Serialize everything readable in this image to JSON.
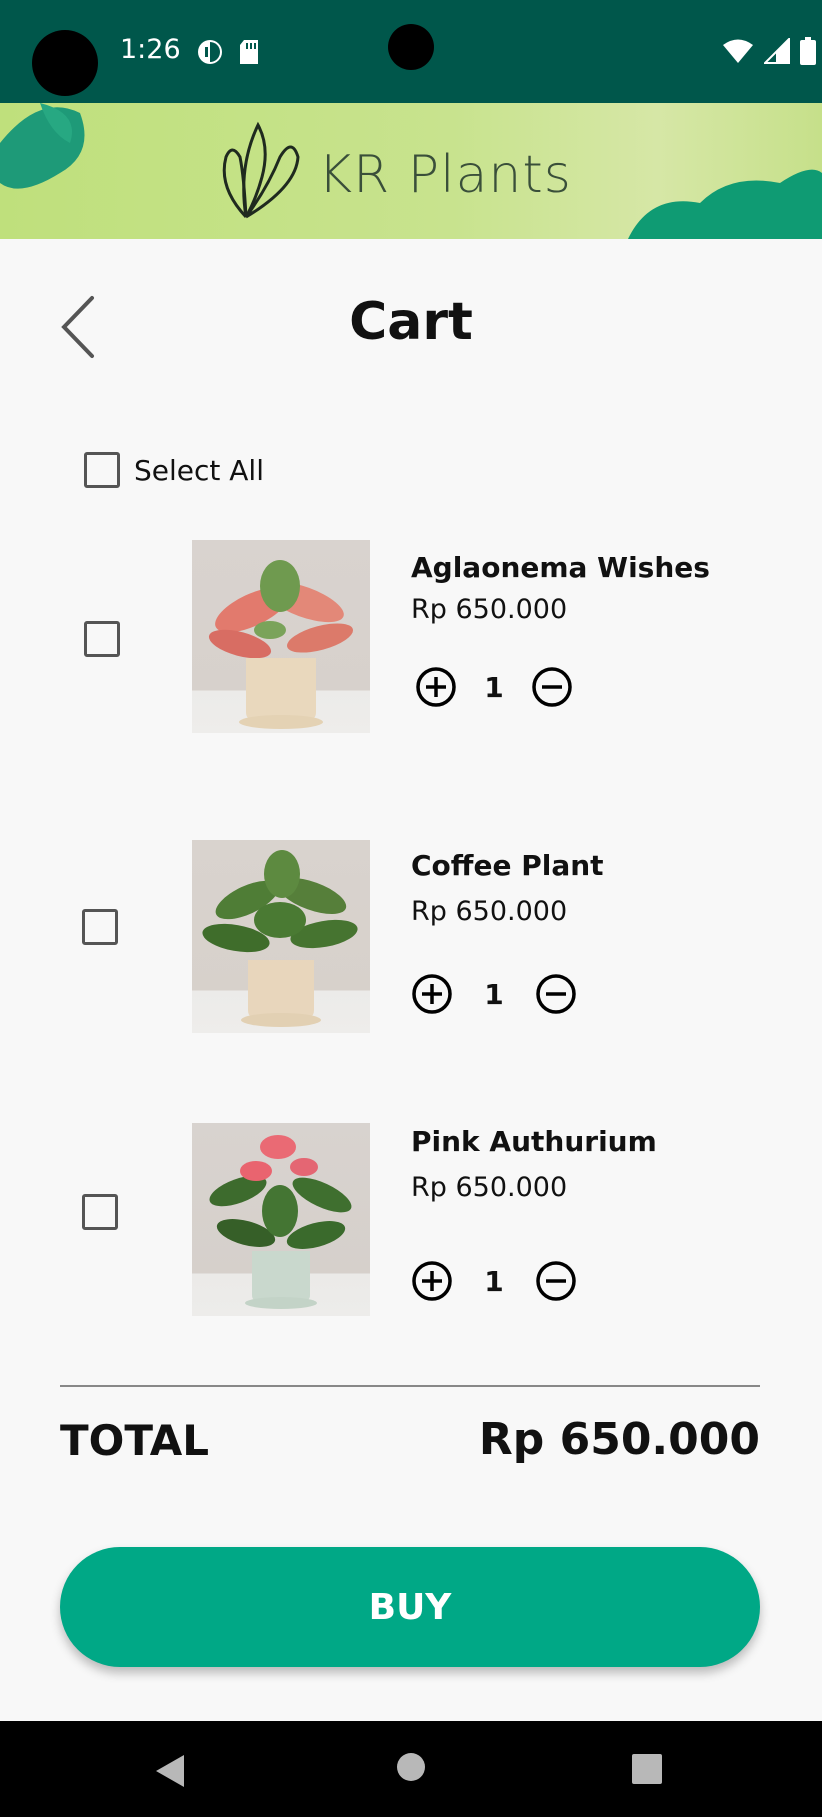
{
  "status_bar": {
    "time": "1:26"
  },
  "banner": {
    "brand": "KR Plants"
  },
  "header": {
    "title": "Cart"
  },
  "select_all": {
    "label": "Select All"
  },
  "items": [
    {
      "name": "Aglaonema Wishes",
      "price": "Rp 650.000",
      "quantity": "1"
    },
    {
      "name": "Coffee Plant",
      "price": "Rp 650.000",
      "quantity": "1"
    },
    {
      "name": "Pink Authurium",
      "price": "Rp 650.000",
      "quantity": "1"
    }
  ],
  "summary": {
    "total_label": "TOTAL",
    "total_value": "Rp 650.000"
  },
  "buy": {
    "label": "BUY"
  },
  "colors": {
    "status_bar": "#00574b",
    "accent": "#00a886",
    "banner": "#c8e38e"
  },
  "icons": [
    "back-icon",
    "plus-circle-icon",
    "minus-circle-icon",
    "wifi-icon",
    "signal-icon",
    "battery-icon"
  ]
}
